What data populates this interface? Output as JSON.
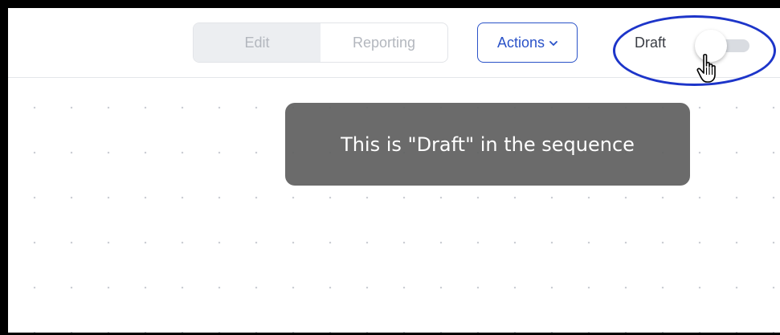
{
  "tabs": [
    {
      "label": "Edit",
      "active": true
    },
    {
      "label": "Reporting",
      "active": false
    }
  ],
  "actions": {
    "label": "Actions",
    "icon": "chevron-down-icon"
  },
  "draft": {
    "label": "Draft",
    "toggle_on": false
  },
  "tooltip": {
    "text": "This is \"Draft\" in the sequence"
  },
  "colors": {
    "accent": "#2a52c8",
    "highlight_ring": "#1d35c9",
    "tooltip_bg": "#606060"
  },
  "cursor": {
    "icon": "hand-pointer-icon"
  }
}
